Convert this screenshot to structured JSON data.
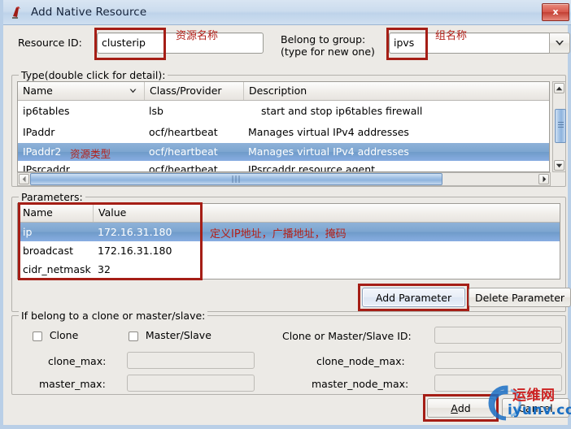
{
  "window": {
    "title": "Add Native Resource",
    "icon": "app-icon",
    "close_label": "x"
  },
  "top_form": {
    "resource_id_label": "Resource ID:",
    "resource_id_value": "clusterip",
    "resource_id_annotation": "资源名称",
    "belong_group_label_line1": "Belong to group:",
    "belong_group_label_line2": "(type for new one)",
    "belong_group_value": "ipvs",
    "belong_group_annotation": "组名称",
    "dropdown_icon": "chevron-down-icon"
  },
  "type_section": {
    "title": "Type(double click for detail):",
    "columns": [
      "Name",
      "Class/Provider",
      "Description"
    ],
    "sort_icon": "chevron-down-icon",
    "rows": [
      {
        "name": "ip6tables",
        "provider": "lsb",
        "description": "start and stop ip6tables firewall",
        "selected": false
      },
      {
        "name": "IPaddr",
        "provider": "ocf/heartbeat",
        "description": "Manages virtual IPv4 addresses",
        "selected": false
      },
      {
        "name": "IPaddr2",
        "provider": "ocf/heartbeat",
        "description": "Manages virtual IPv4 addresses",
        "selected": true
      },
      {
        "name": "IPsrcaddr",
        "provider": "ocf/heartbeat",
        "description": "IPsrcaddr resource agent",
        "selected": false
      }
    ],
    "row_annotation": "资源类型",
    "scroll_up_icon": "caret-up-icon",
    "scroll_down_icon": "caret-down-icon",
    "scroll_left_icon": "caret-left-icon",
    "scroll_right_icon": "caret-right-icon"
  },
  "parameters_section": {
    "title": "Parameters:",
    "columns": [
      "Name",
      "Value"
    ],
    "rows": [
      {
        "name": "ip",
        "value": "172.16.31.180",
        "selected": true
      },
      {
        "name": "broadcast",
        "value": "172.16.31.180",
        "selected": false
      },
      {
        "name": "cidr_netmask",
        "value": "32",
        "selected": false
      }
    ],
    "annotation": "定义IP地址，广播地址，掩码",
    "add_button": "Add Parameter",
    "delete_button": "Delete Parameter"
  },
  "clone_section": {
    "title": "If belong to a clone or master/slave:",
    "clone_checkbox_label": "Clone",
    "clone_checked": false,
    "master_slave_checkbox_label": "Master/Slave",
    "master_slave_checked": false,
    "clone_id_label": "Clone or Master/Slave ID:",
    "clone_id_value": "",
    "clone_max_label": "clone_max:",
    "clone_max_value": "",
    "clone_node_max_label": "clone_node_max:",
    "clone_node_max_value": "",
    "master_max_label": "master_max:",
    "master_max_value": "",
    "master_node_max_label": "master_node_max:",
    "master_node_max_value": ""
  },
  "footer": {
    "add_button": "Add",
    "add_mnemonic": "A",
    "cancel_button": "Cancel"
  },
  "watermark": {
    "top_text": "运维网",
    "bottom_text": "iyunv.com",
    "color_red": "#cc2222",
    "color_blue": "#1a6fc4"
  },
  "colors": {
    "selection_blue": "#7ca5d0",
    "annotation_red": "#b3211a",
    "redbox": "#a51e16",
    "titlebar": "#cbdcee",
    "dialog_bg": "#eceae6"
  }
}
